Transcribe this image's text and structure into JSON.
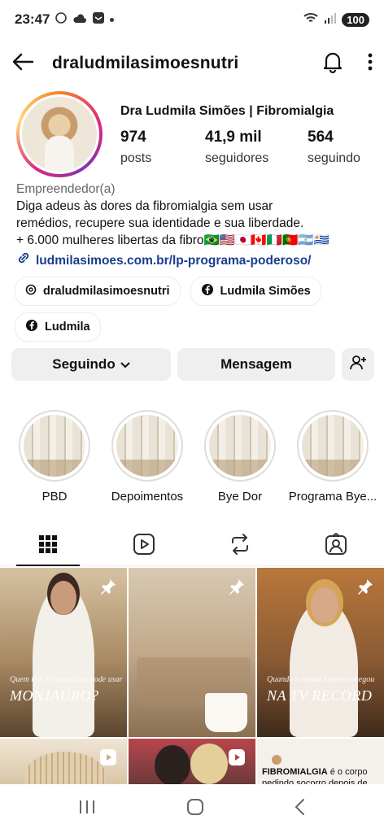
{
  "status_bar": {
    "time": "23:47",
    "battery": "100"
  },
  "header": {
    "username": "draludmilasimoesnutri"
  },
  "profile": {
    "name": "Dra Ludmila Simões | Fibromialgia",
    "stats": [
      {
        "value": "974",
        "label": "posts"
      },
      {
        "value": "41,9 mil",
        "label": "seguidores"
      },
      {
        "value": "564",
        "label": "seguindo"
      }
    ],
    "category": "Empreendedor(a)",
    "bio_line1": "Diga adeus às dores da fibromialgia sem usar",
    "bio_line2": "remédios, recupere sua identidade e sua liberdade.",
    "bio_line3": "+ 6.000 mulheres libertas da fibro🇧🇷🇺🇸🇯🇵🇨🇦🇮🇹🇵🇹🇦🇷🇺🇾",
    "link": "ludmilasimoes.com.br/lp-programa-poderoso/"
  },
  "chips": [
    {
      "icon": "threads-icon",
      "label": "draludmilasimoesnutri"
    },
    {
      "icon": "facebook-icon",
      "label": "Ludmila Simões"
    },
    {
      "icon": "facebook-icon",
      "label": "Ludmila"
    }
  ],
  "actions": {
    "following": "Seguindo",
    "message": "Mensagem"
  },
  "highlights": [
    {
      "label": "PBD"
    },
    {
      "label": "Depoimentos"
    },
    {
      "label": "Bye Dor"
    },
    {
      "label": "Programa Bye..."
    }
  ],
  "tabs": [
    "grid-icon",
    "reels-icon",
    "reposts-icon",
    "tagged-icon"
  ],
  "posts": [
    {
      "small": "Quem tem Fibromialgia pode usar",
      "big": "MONJAURO?"
    },
    {
      "small": "",
      "big": ""
    },
    {
      "small": "Quando a minha história chegou",
      "big": "NA TV RECORD"
    },
    {
      "small": "",
      "big": ""
    },
    {
      "small": "",
      "big": ""
    },
    {
      "small": "",
      "big": "",
      "mini_title": "FIBROMIALGIA",
      "mini_text": "é o corpo pedindo socorro depois de tanto"
    }
  ]
}
